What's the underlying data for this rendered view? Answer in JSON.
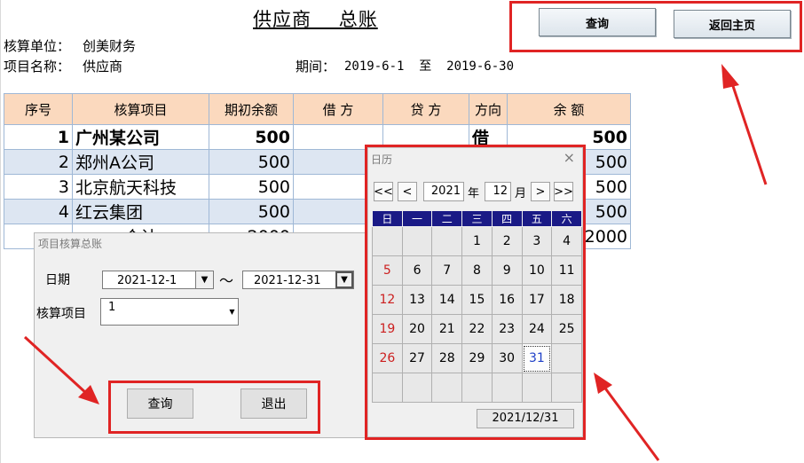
{
  "sheet": {
    "title": "供应商    总账",
    "unit_label": "核算单位：",
    "unit_value": "创美财务",
    "project_label": "项目名称：",
    "project_value": "供应商",
    "period_label": "期间：",
    "period_value": "2019-6-1  至  2019-6-30"
  },
  "toolbar": {
    "query_label": "查询",
    "home_label": "返回主页"
  },
  "ledger": {
    "headers": [
      "序号",
      "核算项目",
      "期初余额",
      "借  方",
      "贷  方",
      "方向",
      "余  额"
    ],
    "rows": [
      {
        "no": "1",
        "item": "广州某公司",
        "opening": "500",
        "debit": "",
        "credit": "",
        "direction": "借",
        "balance": "500"
      },
      {
        "no": "2",
        "item": "郑州A公司",
        "opening": "500",
        "debit": "",
        "credit": "",
        "direction": "",
        "balance": "500"
      },
      {
        "no": "3",
        "item": "北京航天科技",
        "opening": "500",
        "debit": "",
        "credit": "",
        "direction": "",
        "balance": "500"
      },
      {
        "no": "4",
        "item": "红云集团",
        "opening": "500",
        "debit": "",
        "credit": "",
        "direction": "",
        "balance": "500"
      }
    ],
    "total_label": "合计",
    "total_opening": "2000",
    "total_balance": "2000"
  },
  "dialog": {
    "title": "项目核算总账",
    "date_label": "日期",
    "date_from": "2021-12-1",
    "range_sep": "～",
    "date_to": "2021-12-31",
    "item_label": "核算项目",
    "item_value": "1",
    "query_button": "查询",
    "exit_button": "退出"
  },
  "calendar": {
    "title": "日历",
    "close": "×",
    "prev_year": "<<",
    "prev_month": "<",
    "year": "2021",
    "year_unit": "年",
    "month": "12",
    "month_unit": "月",
    "next_month": ">",
    "next_year": ">>",
    "weekdays": [
      "日",
      "一",
      "二",
      "三",
      "四",
      "五",
      "六"
    ],
    "weeks": [
      [
        "",
        "",
        "",
        "1",
        "2",
        "3",
        "4"
      ],
      [
        "5",
        "6",
        "7",
        "8",
        "9",
        "10",
        "11"
      ],
      [
        "12",
        "13",
        "14",
        "15",
        "16",
        "17",
        "18"
      ],
      [
        "19",
        "20",
        "21",
        "22",
        "23",
        "24",
        "25"
      ],
      [
        "26",
        "27",
        "28",
        "29",
        "30",
        "31",
        ""
      ],
      [
        "",
        "",
        "",
        "",
        "",
        "",
        ""
      ]
    ],
    "selected_day": "31",
    "selected_date": "2021/12/31"
  },
  "colors": {
    "highlight_red": "#e02424",
    "header_peach": "#fbd9be",
    "band_blue": "#dde6f2",
    "weekday_navy": "#1a1a86"
  }
}
